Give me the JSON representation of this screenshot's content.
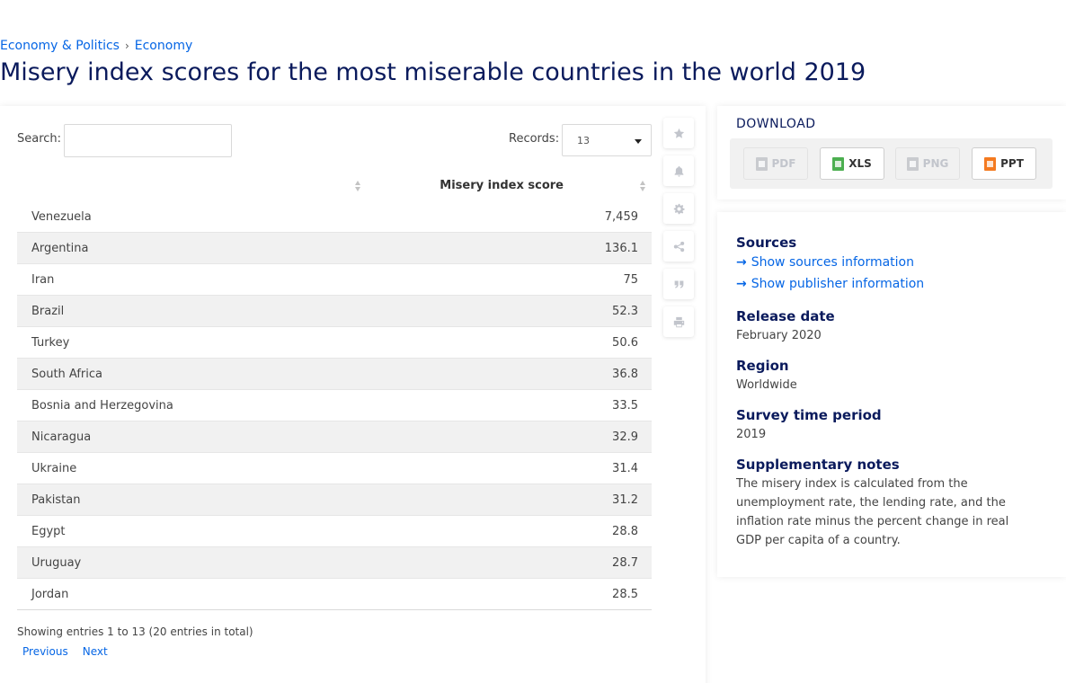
{
  "breadcrumb": {
    "items": [
      "Economy & Politics",
      "Economy"
    ],
    "separator": "›"
  },
  "page_title": "Misery index scores for the most miserable countries in the world 2019",
  "table_controls": {
    "search_label": "Search:",
    "search_value": "",
    "records_label": "Records:",
    "records_value": "13"
  },
  "table": {
    "columns": [
      "",
      "Misery index score"
    ],
    "rows": [
      {
        "country": "Venezuela",
        "score": "7,459"
      },
      {
        "country": "Argentina",
        "score": "136.1"
      },
      {
        "country": "Iran",
        "score": "75"
      },
      {
        "country": "Brazil",
        "score": "52.3"
      },
      {
        "country": "Turkey",
        "score": "50.6"
      },
      {
        "country": "South Africa",
        "score": "36.8"
      },
      {
        "country": "Bosnia and Herzegovina",
        "score": "33.5"
      },
      {
        "country": "Nicaragua",
        "score": "32.9"
      },
      {
        "country": "Ukraine",
        "score": "31.4"
      },
      {
        "country": "Pakistan",
        "score": "31.2"
      },
      {
        "country": "Egypt",
        "score": "28.8"
      },
      {
        "country": "Uruguay",
        "score": "28.7"
      },
      {
        "country": "Jordan",
        "score": "28.5"
      }
    ]
  },
  "pagination": {
    "info": "Showing entries 1 to 13 (20 entries in total)",
    "previous": "Previous",
    "next": "Next"
  },
  "toolbar_icons": [
    "star-icon",
    "bell-icon",
    "gear-icon",
    "share-icon",
    "quote-icon",
    "print-icon"
  ],
  "download": {
    "title": "DOWNLOAD",
    "buttons": [
      {
        "label": "PDF",
        "enabled": false
      },
      {
        "label": "XLS",
        "enabled": true
      },
      {
        "label": "PNG",
        "enabled": false
      },
      {
        "label": "PPT",
        "enabled": true
      }
    ]
  },
  "info": {
    "sources_title": "Sources",
    "show_sources": "Show sources information",
    "show_publisher": "Show publisher information",
    "release_date_title": "Release date",
    "release_date": "February 2020",
    "region_title": "Region",
    "region": "Worldwide",
    "survey_period_title": "Survey time period",
    "survey_period": "2019",
    "notes_title": "Supplementary notes",
    "notes": "The misery index is calculated from the unemployment rate, the lending rate, and the inflation rate minus the percent change in real GDP per capita of a country."
  },
  "colors": {
    "title": "#0a1a5c",
    "link": "#0666e5",
    "stripe": "#f1f1f1",
    "xls": "#4caf50",
    "ppt": "#f47a20"
  }
}
